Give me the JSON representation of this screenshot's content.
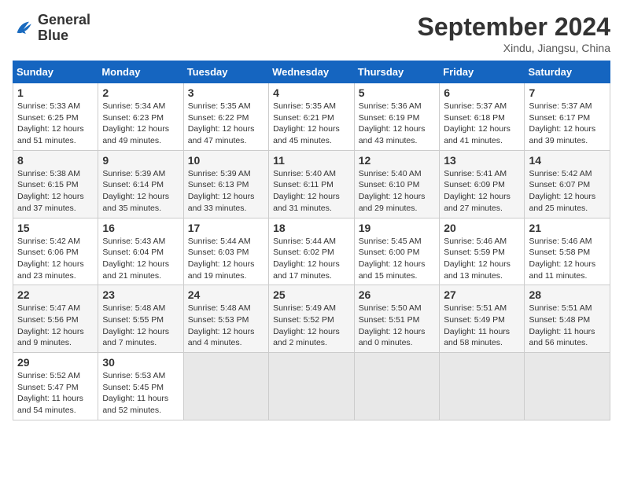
{
  "header": {
    "logo_line1": "General",
    "logo_line2": "Blue",
    "month": "September 2024",
    "location": "Xindu, Jiangsu, China"
  },
  "weekdays": [
    "Sunday",
    "Monday",
    "Tuesday",
    "Wednesday",
    "Thursday",
    "Friday",
    "Saturday"
  ],
  "weeks": [
    [
      {
        "day": "1",
        "info": "Sunrise: 5:33 AM\nSunset: 6:25 PM\nDaylight: 12 hours\nand 51 minutes."
      },
      {
        "day": "2",
        "info": "Sunrise: 5:34 AM\nSunset: 6:23 PM\nDaylight: 12 hours\nand 49 minutes."
      },
      {
        "day": "3",
        "info": "Sunrise: 5:35 AM\nSunset: 6:22 PM\nDaylight: 12 hours\nand 47 minutes."
      },
      {
        "day": "4",
        "info": "Sunrise: 5:35 AM\nSunset: 6:21 PM\nDaylight: 12 hours\nand 45 minutes."
      },
      {
        "day": "5",
        "info": "Sunrise: 5:36 AM\nSunset: 6:19 PM\nDaylight: 12 hours\nand 43 minutes."
      },
      {
        "day": "6",
        "info": "Sunrise: 5:37 AM\nSunset: 6:18 PM\nDaylight: 12 hours\nand 41 minutes."
      },
      {
        "day": "7",
        "info": "Sunrise: 5:37 AM\nSunset: 6:17 PM\nDaylight: 12 hours\nand 39 minutes."
      }
    ],
    [
      {
        "day": "8",
        "info": "Sunrise: 5:38 AM\nSunset: 6:15 PM\nDaylight: 12 hours\nand 37 minutes."
      },
      {
        "day": "9",
        "info": "Sunrise: 5:39 AM\nSunset: 6:14 PM\nDaylight: 12 hours\nand 35 minutes."
      },
      {
        "day": "10",
        "info": "Sunrise: 5:39 AM\nSunset: 6:13 PM\nDaylight: 12 hours\nand 33 minutes."
      },
      {
        "day": "11",
        "info": "Sunrise: 5:40 AM\nSunset: 6:11 PM\nDaylight: 12 hours\nand 31 minutes."
      },
      {
        "day": "12",
        "info": "Sunrise: 5:40 AM\nSunset: 6:10 PM\nDaylight: 12 hours\nand 29 minutes."
      },
      {
        "day": "13",
        "info": "Sunrise: 5:41 AM\nSunset: 6:09 PM\nDaylight: 12 hours\nand 27 minutes."
      },
      {
        "day": "14",
        "info": "Sunrise: 5:42 AM\nSunset: 6:07 PM\nDaylight: 12 hours\nand 25 minutes."
      }
    ],
    [
      {
        "day": "15",
        "info": "Sunrise: 5:42 AM\nSunset: 6:06 PM\nDaylight: 12 hours\nand 23 minutes."
      },
      {
        "day": "16",
        "info": "Sunrise: 5:43 AM\nSunset: 6:04 PM\nDaylight: 12 hours\nand 21 minutes."
      },
      {
        "day": "17",
        "info": "Sunrise: 5:44 AM\nSunset: 6:03 PM\nDaylight: 12 hours\nand 19 minutes."
      },
      {
        "day": "18",
        "info": "Sunrise: 5:44 AM\nSunset: 6:02 PM\nDaylight: 12 hours\nand 17 minutes."
      },
      {
        "day": "19",
        "info": "Sunrise: 5:45 AM\nSunset: 6:00 PM\nDaylight: 12 hours\nand 15 minutes."
      },
      {
        "day": "20",
        "info": "Sunrise: 5:46 AM\nSunset: 5:59 PM\nDaylight: 12 hours\nand 13 minutes."
      },
      {
        "day": "21",
        "info": "Sunrise: 5:46 AM\nSunset: 5:58 PM\nDaylight: 12 hours\nand 11 minutes."
      }
    ],
    [
      {
        "day": "22",
        "info": "Sunrise: 5:47 AM\nSunset: 5:56 PM\nDaylight: 12 hours\nand 9 minutes."
      },
      {
        "day": "23",
        "info": "Sunrise: 5:48 AM\nSunset: 5:55 PM\nDaylight: 12 hours\nand 7 minutes."
      },
      {
        "day": "24",
        "info": "Sunrise: 5:48 AM\nSunset: 5:53 PM\nDaylight: 12 hours\nand 4 minutes."
      },
      {
        "day": "25",
        "info": "Sunrise: 5:49 AM\nSunset: 5:52 PM\nDaylight: 12 hours\nand 2 minutes."
      },
      {
        "day": "26",
        "info": "Sunrise: 5:50 AM\nSunset: 5:51 PM\nDaylight: 12 hours\nand 0 minutes."
      },
      {
        "day": "27",
        "info": "Sunrise: 5:51 AM\nSunset: 5:49 PM\nDaylight: 11 hours\nand 58 minutes."
      },
      {
        "day": "28",
        "info": "Sunrise: 5:51 AM\nSunset: 5:48 PM\nDaylight: 11 hours\nand 56 minutes."
      }
    ],
    [
      {
        "day": "29",
        "info": "Sunrise: 5:52 AM\nSunset: 5:47 PM\nDaylight: 11 hours\nand 54 minutes."
      },
      {
        "day": "30",
        "info": "Sunrise: 5:53 AM\nSunset: 5:45 PM\nDaylight: 11 hours\nand 52 minutes."
      },
      {
        "day": "",
        "info": ""
      },
      {
        "day": "",
        "info": ""
      },
      {
        "day": "",
        "info": ""
      },
      {
        "day": "",
        "info": ""
      },
      {
        "day": "",
        "info": ""
      }
    ]
  ]
}
